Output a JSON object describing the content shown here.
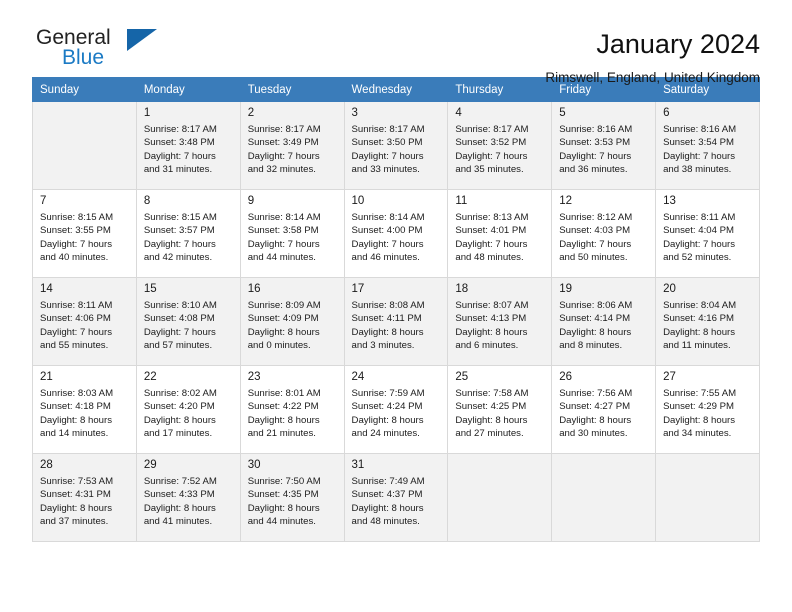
{
  "brand": {
    "word_one": "General",
    "word_two": "Blue",
    "accent_color": "#1b7ac4",
    "triangle_color": "#1565a8"
  },
  "header": {
    "title": "January 2024",
    "subtitle": "Rimswell, England, United Kingdom",
    "header_bg": "#3a7cba",
    "shaded_row_bg": "#f2f2f2"
  },
  "weekdays": [
    "Sunday",
    "Monday",
    "Tuesday",
    "Wednesday",
    "Thursday",
    "Friday",
    "Saturday"
  ],
  "weeks": [
    [
      {
        "day": "",
        "sunrise": "",
        "sunset": "",
        "daylight_line1": "",
        "daylight_line2": ""
      },
      {
        "day": "1",
        "sunrise": "Sunrise: 8:17 AM",
        "sunset": "Sunset: 3:48 PM",
        "daylight_line1": "Daylight: 7 hours",
        "daylight_line2": "and 31 minutes."
      },
      {
        "day": "2",
        "sunrise": "Sunrise: 8:17 AM",
        "sunset": "Sunset: 3:49 PM",
        "daylight_line1": "Daylight: 7 hours",
        "daylight_line2": "and 32 minutes."
      },
      {
        "day": "3",
        "sunrise": "Sunrise: 8:17 AM",
        "sunset": "Sunset: 3:50 PM",
        "daylight_line1": "Daylight: 7 hours",
        "daylight_line2": "and 33 minutes."
      },
      {
        "day": "4",
        "sunrise": "Sunrise: 8:17 AM",
        "sunset": "Sunset: 3:52 PM",
        "daylight_line1": "Daylight: 7 hours",
        "daylight_line2": "and 35 minutes."
      },
      {
        "day": "5",
        "sunrise": "Sunrise: 8:16 AM",
        "sunset": "Sunset: 3:53 PM",
        "daylight_line1": "Daylight: 7 hours",
        "daylight_line2": "and 36 minutes."
      },
      {
        "day": "6",
        "sunrise": "Sunrise: 8:16 AM",
        "sunset": "Sunset: 3:54 PM",
        "daylight_line1": "Daylight: 7 hours",
        "daylight_line2": "and 38 minutes."
      }
    ],
    [
      {
        "day": "7",
        "sunrise": "Sunrise: 8:15 AM",
        "sunset": "Sunset: 3:55 PM",
        "daylight_line1": "Daylight: 7 hours",
        "daylight_line2": "and 40 minutes."
      },
      {
        "day": "8",
        "sunrise": "Sunrise: 8:15 AM",
        "sunset": "Sunset: 3:57 PM",
        "daylight_line1": "Daylight: 7 hours",
        "daylight_line2": "and 42 minutes."
      },
      {
        "day": "9",
        "sunrise": "Sunrise: 8:14 AM",
        "sunset": "Sunset: 3:58 PM",
        "daylight_line1": "Daylight: 7 hours",
        "daylight_line2": "and 44 minutes."
      },
      {
        "day": "10",
        "sunrise": "Sunrise: 8:14 AM",
        "sunset": "Sunset: 4:00 PM",
        "daylight_line1": "Daylight: 7 hours",
        "daylight_line2": "and 46 minutes."
      },
      {
        "day": "11",
        "sunrise": "Sunrise: 8:13 AM",
        "sunset": "Sunset: 4:01 PM",
        "daylight_line1": "Daylight: 7 hours",
        "daylight_line2": "and 48 minutes."
      },
      {
        "day": "12",
        "sunrise": "Sunrise: 8:12 AM",
        "sunset": "Sunset: 4:03 PM",
        "daylight_line1": "Daylight: 7 hours",
        "daylight_line2": "and 50 minutes."
      },
      {
        "day": "13",
        "sunrise": "Sunrise: 8:11 AM",
        "sunset": "Sunset: 4:04 PM",
        "daylight_line1": "Daylight: 7 hours",
        "daylight_line2": "and 52 minutes."
      }
    ],
    [
      {
        "day": "14",
        "sunrise": "Sunrise: 8:11 AM",
        "sunset": "Sunset: 4:06 PM",
        "daylight_line1": "Daylight: 7 hours",
        "daylight_line2": "and 55 minutes."
      },
      {
        "day": "15",
        "sunrise": "Sunrise: 8:10 AM",
        "sunset": "Sunset: 4:08 PM",
        "daylight_line1": "Daylight: 7 hours",
        "daylight_line2": "and 57 minutes."
      },
      {
        "day": "16",
        "sunrise": "Sunrise: 8:09 AM",
        "sunset": "Sunset: 4:09 PM",
        "daylight_line1": "Daylight: 8 hours",
        "daylight_line2": "and 0 minutes."
      },
      {
        "day": "17",
        "sunrise": "Sunrise: 8:08 AM",
        "sunset": "Sunset: 4:11 PM",
        "daylight_line1": "Daylight: 8 hours",
        "daylight_line2": "and 3 minutes."
      },
      {
        "day": "18",
        "sunrise": "Sunrise: 8:07 AM",
        "sunset": "Sunset: 4:13 PM",
        "daylight_line1": "Daylight: 8 hours",
        "daylight_line2": "and 6 minutes."
      },
      {
        "day": "19",
        "sunrise": "Sunrise: 8:06 AM",
        "sunset": "Sunset: 4:14 PM",
        "daylight_line1": "Daylight: 8 hours",
        "daylight_line2": "and 8 minutes."
      },
      {
        "day": "20",
        "sunrise": "Sunrise: 8:04 AM",
        "sunset": "Sunset: 4:16 PM",
        "daylight_line1": "Daylight: 8 hours",
        "daylight_line2": "and 11 minutes."
      }
    ],
    [
      {
        "day": "21",
        "sunrise": "Sunrise: 8:03 AM",
        "sunset": "Sunset: 4:18 PM",
        "daylight_line1": "Daylight: 8 hours",
        "daylight_line2": "and 14 minutes."
      },
      {
        "day": "22",
        "sunrise": "Sunrise: 8:02 AM",
        "sunset": "Sunset: 4:20 PM",
        "daylight_line1": "Daylight: 8 hours",
        "daylight_line2": "and 17 minutes."
      },
      {
        "day": "23",
        "sunrise": "Sunrise: 8:01 AM",
        "sunset": "Sunset: 4:22 PM",
        "daylight_line1": "Daylight: 8 hours",
        "daylight_line2": "and 21 minutes."
      },
      {
        "day": "24",
        "sunrise": "Sunrise: 7:59 AM",
        "sunset": "Sunset: 4:24 PM",
        "daylight_line1": "Daylight: 8 hours",
        "daylight_line2": "and 24 minutes."
      },
      {
        "day": "25",
        "sunrise": "Sunrise: 7:58 AM",
        "sunset": "Sunset: 4:25 PM",
        "daylight_line1": "Daylight: 8 hours",
        "daylight_line2": "and 27 minutes."
      },
      {
        "day": "26",
        "sunrise": "Sunrise: 7:56 AM",
        "sunset": "Sunset: 4:27 PM",
        "daylight_line1": "Daylight: 8 hours",
        "daylight_line2": "and 30 minutes."
      },
      {
        "day": "27",
        "sunrise": "Sunrise: 7:55 AM",
        "sunset": "Sunset: 4:29 PM",
        "daylight_line1": "Daylight: 8 hours",
        "daylight_line2": "and 34 minutes."
      }
    ],
    [
      {
        "day": "28",
        "sunrise": "Sunrise: 7:53 AM",
        "sunset": "Sunset: 4:31 PM",
        "daylight_line1": "Daylight: 8 hours",
        "daylight_line2": "and 37 minutes."
      },
      {
        "day": "29",
        "sunrise": "Sunrise: 7:52 AM",
        "sunset": "Sunset: 4:33 PM",
        "daylight_line1": "Daylight: 8 hours",
        "daylight_line2": "and 41 minutes."
      },
      {
        "day": "30",
        "sunrise": "Sunrise: 7:50 AM",
        "sunset": "Sunset: 4:35 PM",
        "daylight_line1": "Daylight: 8 hours",
        "daylight_line2": "and 44 minutes."
      },
      {
        "day": "31",
        "sunrise": "Sunrise: 7:49 AM",
        "sunset": "Sunset: 4:37 PM",
        "daylight_line1": "Daylight: 8 hours",
        "daylight_line2": "and 48 minutes."
      },
      {
        "day": "",
        "sunrise": "",
        "sunset": "",
        "daylight_line1": "",
        "daylight_line2": ""
      },
      {
        "day": "",
        "sunrise": "",
        "sunset": "",
        "daylight_line1": "",
        "daylight_line2": ""
      },
      {
        "day": "",
        "sunrise": "",
        "sunset": "",
        "daylight_line1": "",
        "daylight_line2": ""
      }
    ]
  ]
}
